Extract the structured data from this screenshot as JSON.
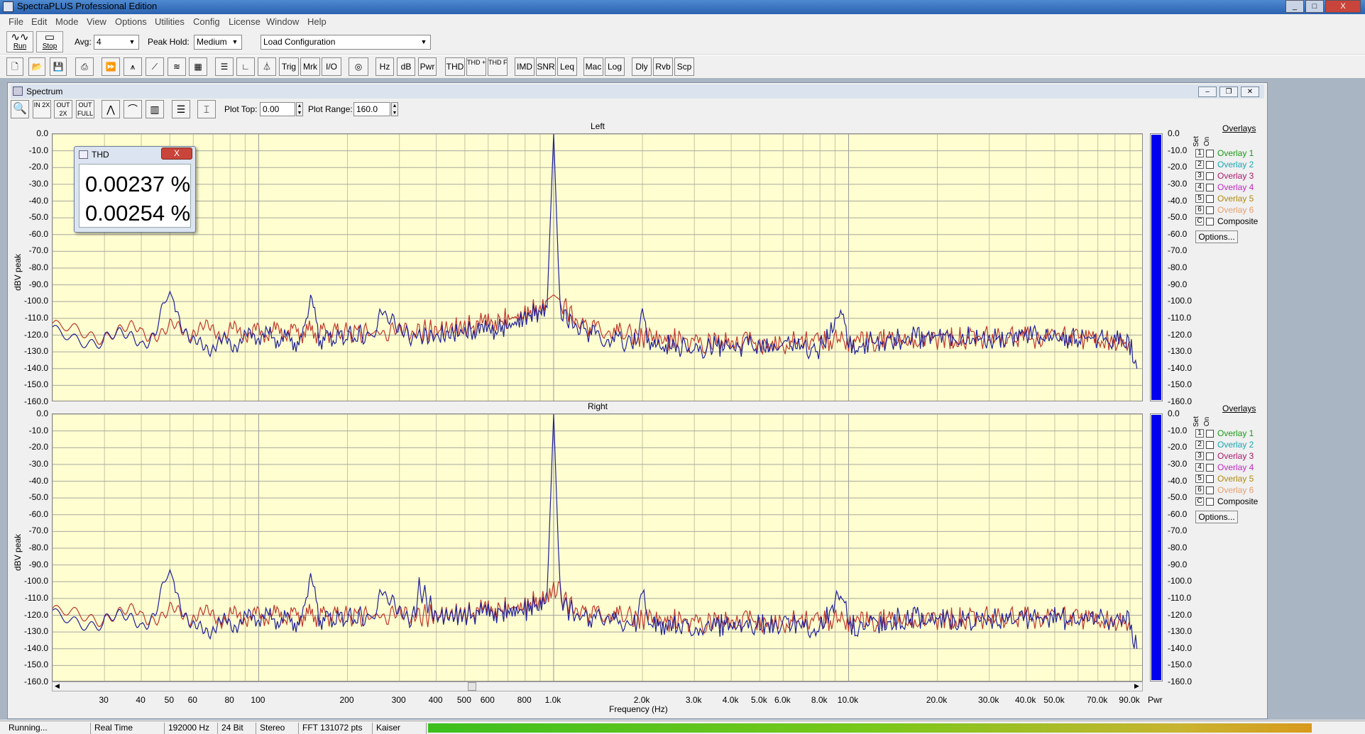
{
  "window": {
    "title": "SpectraPLUS Professional Edition"
  },
  "menu": [
    "File",
    "Edit",
    "Mode",
    "View",
    "Options",
    "Utilities",
    "Config",
    "License",
    "Window",
    "Help"
  ],
  "toolbar1": {
    "run_label": "Run",
    "stop_label": "Stop",
    "avg_label": "Avg:",
    "avg_value": "4",
    "peak_hold_label": "Peak Hold:",
    "peak_hold_value": "Medium",
    "config_value": "Load Configuration"
  },
  "toolbar2": {
    "trig": "Trig",
    "mrk": "Mrk",
    "io": "I/O",
    "hz": "Hz",
    "db": "dB",
    "pwr": "Pwr",
    "thd": "THD",
    "thdn": "THD +N",
    "thdfreq": "THD Freq",
    "imd": "IMD",
    "snr": "SNR",
    "leq": "Leq",
    "mac": "Mac",
    "log": "Log",
    "dly": "Dly",
    "rvb": "Rvb",
    "scp": "Scp"
  },
  "spectrum": {
    "title": "Spectrum",
    "zoom_in": "IN 2X",
    "zoom_out": "OUT 2X",
    "zoom_full": "OUT FULL",
    "plot_top_label": "Plot Top:",
    "plot_top_value": "0.00",
    "plot_range_label": "Plot Range:",
    "plot_range_value": "160.0",
    "ylabel": "dBV peak",
    "xlabel": "Frequency (Hz)",
    "yticks": [
      "0.0",
      "-10.0",
      "-20.0",
      "-30.0",
      "-40.0",
      "-50.0",
      "-60.0",
      "-70.0",
      "-80.0",
      "-90.0",
      "-100.0",
      "-110.0",
      "-120.0",
      "-130.0",
      "-140.0",
      "-150.0",
      "-160.0"
    ],
    "xticks": [
      "30",
      "40",
      "50",
      "60",
      "80",
      "100",
      "200",
      "300",
      "400",
      "500",
      "600",
      "800",
      "1.0k",
      "2.0k",
      "3.0k",
      "4.0k",
      "5.0k",
      "6.0k",
      "8.0k",
      "10.0k",
      "20.0k",
      "30.0k",
      "40.0k",
      "50.0k",
      "70.0k",
      "90.0k"
    ],
    "bar_unit": "Pwr",
    "overlays_title": "Overlays",
    "set_label": "Set",
    "on_label": "On",
    "overlays": [
      {
        "set": "1",
        "label": "Overlay 1",
        "color": "#1a9a1a"
      },
      {
        "set": "2",
        "label": "Overlay 2",
        "color": "#1aa6b0"
      },
      {
        "set": "3",
        "label": "Overlay 3",
        "color": "#b01a6a"
      },
      {
        "set": "4",
        "label": "Overlay 4",
        "color": "#c02ac0"
      },
      {
        "set": "5",
        "label": "Overlay 5",
        "color": "#b08a10"
      },
      {
        "set": "6",
        "label": "Overlay 6",
        "color": "#e8a070"
      },
      {
        "set": "C",
        "label": "Composite",
        "color": "#000000"
      }
    ],
    "options_label": "Options...",
    "trace_colors": {
      "primary": "#20209a",
      "secondary": "#c0392b"
    }
  },
  "chart_data": [
    {
      "type": "line",
      "title": "Left",
      "xlabel": "Frequency (Hz)",
      "ylabel": "dBV peak",
      "x_scale": "log",
      "xlim": [
        20,
        100000
      ],
      "ylim": [
        -160,
        0
      ],
      "bar_level_db": -160,
      "series": [
        {
          "color": "#20209a",
          "x": [
            20,
            30,
            40,
            45,
            50,
            55,
            60,
            70,
            80,
            100,
            140,
            150,
            160,
            200,
            250,
            260,
            300,
            400,
            500,
            600,
            700,
            800,
            900,
            950,
            1000,
            1050,
            1100,
            1200,
            1500,
            1900,
            2000,
            2100,
            3000,
            5000,
            8000,
            9500,
            10000,
            10500,
            15000,
            20000,
            30000,
            40000,
            50000,
            70000,
            90000,
            95000
          ],
          "y": [
            -120,
            -122,
            -123,
            -118,
            -94,
            -112,
            -127,
            -126,
            -125,
            -120,
            -124,
            -96,
            -122,
            -121,
            -120,
            -103,
            -120,
            -121,
            -118,
            -118,
            -115,
            -110,
            -105,
            -102,
            0,
            -104,
            -110,
            -115,
            -122,
            -124,
            -104,
            -125,
            -127,
            -127,
            -128,
            -104,
            -127,
            -126,
            -122,
            -121,
            -122,
            -121,
            -122,
            -122,
            -125,
            -140
          ]
        },
        {
          "color": "#c0392b",
          "x": [
            20,
            30,
            40,
            50,
            60,
            80,
            100,
            200,
            300,
            400,
            500,
            600,
            800,
            900,
            950,
            1000,
            1050,
            1100,
            1200,
            1500,
            2000,
            3000,
            5000,
            10000,
            20000,
            50000,
            90000
          ],
          "y": [
            -118,
            -119,
            -118,
            -117,
            -117,
            -118,
            -118,
            -118,
            -119,
            -117,
            -115,
            -113,
            -108,
            -103,
            -99,
            -96,
            -99,
            -104,
            -112,
            -118,
            -121,
            -124,
            -125,
            -124,
            -122,
            -121,
            -124
          ]
        }
      ]
    },
    {
      "type": "line",
      "title": "Right",
      "xlabel": "Frequency (Hz)",
      "ylabel": "dBV peak",
      "x_scale": "log",
      "xlim": [
        20,
        100000
      ],
      "ylim": [
        -160,
        0
      ],
      "bar_level_db": -160,
      "series": [
        {
          "color": "#20209a",
          "x": [
            20,
            30,
            40,
            45,
            50,
            55,
            60,
            70,
            80,
            100,
            140,
            150,
            160,
            200,
            250,
            260,
            300,
            340,
            350,
            400,
            500,
            600,
            700,
            800,
            900,
            950,
            1000,
            1050,
            1100,
            1200,
            1500,
            1900,
            2000,
            2100,
            3000,
            5000,
            8000,
            9500,
            10000,
            10500,
            15000,
            20000,
            30000,
            40000,
            50000,
            70000,
            90000,
            95000
          ],
          "y": [
            -122,
            -123,
            -124,
            -118,
            -93,
            -114,
            -130,
            -127,
            -125,
            -121,
            -124,
            -95,
            -122,
            -122,
            -121,
            -103,
            -121,
            -121,
            -103,
            -121,
            -120,
            -119,
            -118,
            -117,
            -113,
            -108,
            0,
            -106,
            -115,
            -120,
            -124,
            -125,
            -103,
            -125,
            -126,
            -126,
            -127,
            -104,
            -127,
            -126,
            -122,
            -122,
            -123,
            -122,
            -122,
            -122,
            -124,
            -140
          ]
        },
        {
          "color": "#c0392b",
          "x": [
            20,
            30,
            40,
            50,
            60,
            80,
            100,
            200,
            300,
            400,
            500,
            600,
            800,
            900,
            950,
            1000,
            1050,
            1100,
            1200,
            1500,
            2000,
            3000,
            5000,
            10000,
            20000,
            50000,
            90000
          ],
          "y": [
            -121,
            -120,
            -120,
            -119,
            -120,
            -121,
            -120,
            -120,
            -121,
            -120,
            -119,
            -117,
            -115,
            -110,
            -106,
            -103,
            -107,
            -112,
            -117,
            -120,
            -122,
            -124,
            -124,
            -124,
            -122,
            -121,
            -124
          ]
        }
      ]
    }
  ],
  "thd_window": {
    "title": "THD",
    "close": "X",
    "values": [
      "0.00237 %",
      "0.00254 %"
    ]
  },
  "statusbar": {
    "state": "Running...",
    "mode": "Real Time",
    "rate": "192000 Hz",
    "bits": "24 Bit",
    "channels": "Stereo",
    "fft": "FFT 131072 pts",
    "window": "Kaiser"
  }
}
